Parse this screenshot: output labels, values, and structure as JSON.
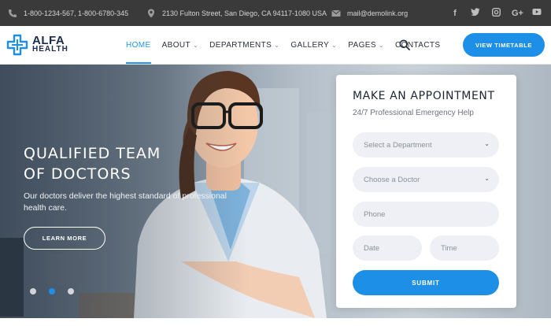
{
  "topbar": {
    "phones": "1-800-1234-567,  1-800-6780-345",
    "address": "2130 Fulton Street, San Diego, CA 94117-1080 USA",
    "email": "mail@demolink.org",
    "social": [
      {
        "name": "facebook-icon",
        "glyph": "f"
      },
      {
        "name": "twitter-icon",
        "glyph": "t"
      },
      {
        "name": "instagram-icon",
        "glyph": "◘"
      },
      {
        "name": "google-plus-icon",
        "glyph": "G+"
      },
      {
        "name": "youtube-icon",
        "glyph": "▶"
      }
    ]
  },
  "header": {
    "logo_line1": "ALFA",
    "logo_line2": "HEALTH",
    "nav": [
      {
        "label": "HOME",
        "active": true,
        "has_dropdown": false
      },
      {
        "label": "ABOUT",
        "active": false,
        "has_dropdown": true
      },
      {
        "label": "DEPARTMENTS",
        "active": false,
        "has_dropdown": true
      },
      {
        "label": "GALLERY",
        "active": false,
        "has_dropdown": true
      },
      {
        "label": "PAGES",
        "active": false,
        "has_dropdown": true
      },
      {
        "label": "CONTACTS",
        "active": false,
        "has_dropdown": false
      }
    ],
    "timetable_label": "VIEW TIMETABLE"
  },
  "hero": {
    "title_line1": "QUALIFIED TEAM",
    "title_line2": "OF DOCTORS",
    "text": "Our doctors deliver the highest standard of professional health care.",
    "button_label": "LEARN MORE",
    "slides_total": 3,
    "slide_active": 2
  },
  "appointment": {
    "title": "MAKE AN APPOINTMENT",
    "subtitle": "24/7 Professional Emergency Help",
    "department_placeholder": "Select a Department",
    "doctor_placeholder": "Choose a Doctor",
    "phone_placeholder": "Phone",
    "date_placeholder": "Date",
    "time_placeholder": "Time",
    "submit_label": "SUBMIT"
  },
  "colors": {
    "accent": "#1e8fe6",
    "topbar_bg": "#3a3a3a",
    "heading": "#1f2533"
  }
}
